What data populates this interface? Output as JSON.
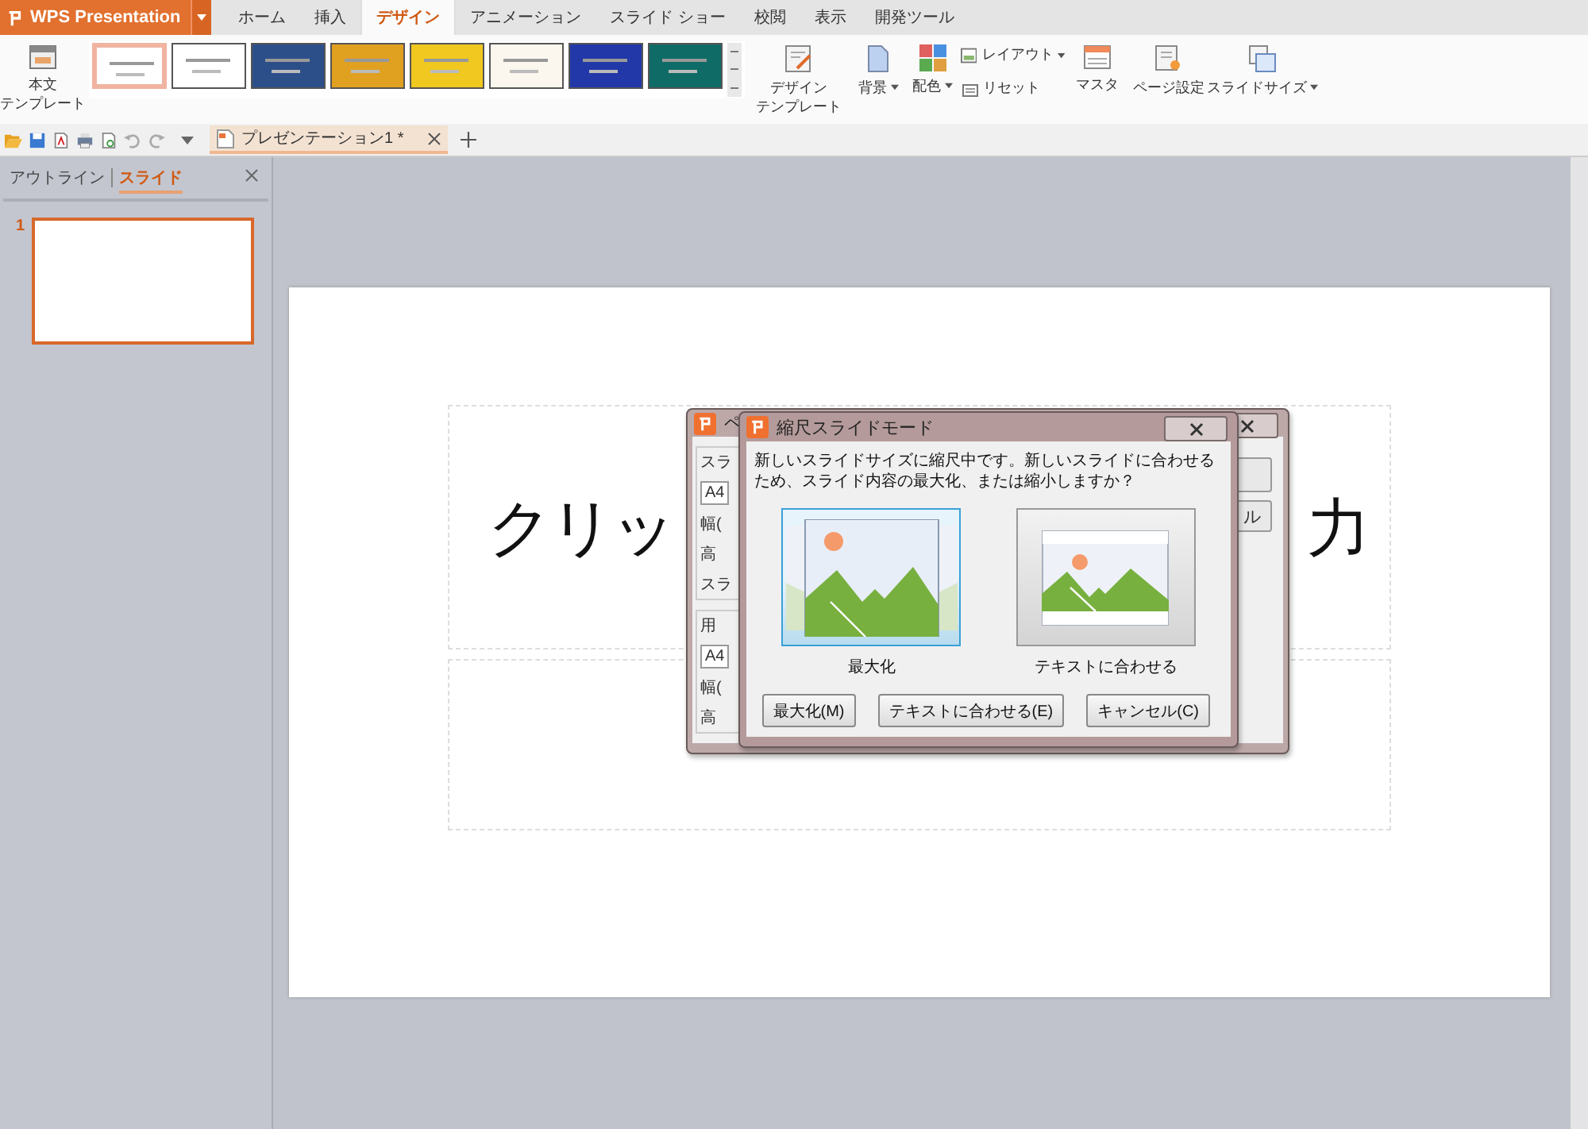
{
  "app": {
    "name": "WPS Presentation"
  },
  "menu_tabs": [
    {
      "label": "ホーム",
      "selected": false
    },
    {
      "label": "挿入",
      "selected": false
    },
    {
      "label": "デザイン",
      "selected": true
    },
    {
      "label": "アニメーション",
      "selected": false
    },
    {
      "label": "スライド ショー",
      "selected": false
    },
    {
      "label": "校閲",
      "selected": false
    },
    {
      "label": "表示",
      "selected": false
    },
    {
      "label": "開発ツール",
      "selected": false
    }
  ],
  "ribbon": {
    "body_template": [
      "本文",
      "テンプレート"
    ],
    "themes": [
      {
        "selected": true,
        "color": "#ffffff"
      },
      {
        "selected": false,
        "color": "#ffffff"
      },
      {
        "selected": false,
        "color": "#2c4f8a"
      },
      {
        "selected": false,
        "color": "#e0a020"
      },
      {
        "selected": false,
        "color": "#f0c820"
      },
      {
        "selected": false,
        "color": "#fbf6ee"
      },
      {
        "selected": false,
        "color": "#2238a8"
      },
      {
        "selected": false,
        "color": "#0f6b66"
      }
    ],
    "design_template": [
      "デザイン",
      "テンプレート"
    ],
    "background": "背景",
    "color_scheme": "配色",
    "layout": "レイアウト",
    "reset": "リセット",
    "master": "マスタ",
    "page_setup": "ページ設定",
    "slide_size": "スライドサイズ"
  },
  "document_tab": {
    "title": "プレゼンテーション1 *"
  },
  "side_panel": {
    "tabs": [
      {
        "label": "アウトライン",
        "selected": false
      },
      {
        "label": "スライド",
        "selected": true
      }
    ],
    "slides": [
      {
        "number": "1",
        "selected": true
      }
    ]
  },
  "slide": {
    "title_start": "クリッ",
    "title_end": "力"
  },
  "page_setup_dialog": {
    "title": "ペ",
    "group_1": "スラ",
    "size_1": "A4",
    "width_1": "幅(",
    "height_1": "高",
    "orientation": "スラ",
    "group_2": "用",
    "size_2": "A4",
    "width_2": "幅(",
    "height_2": "高",
    "cancel_fragment": "ル"
  },
  "scale_dialog": {
    "title": "縮尺スライドモード",
    "message": "新しいスライドサイズに縮尺中です。新しいスライドに合わせるため、スライド内容の最大化、または縮小しますか？",
    "options": [
      {
        "label": "最大化",
        "selected": true
      },
      {
        "label": "テキストに合わせる",
        "selected": false
      }
    ],
    "buttons": [
      "最大化(M)",
      "テキストに合わせる(E)",
      "キャンセル(C)"
    ]
  }
}
